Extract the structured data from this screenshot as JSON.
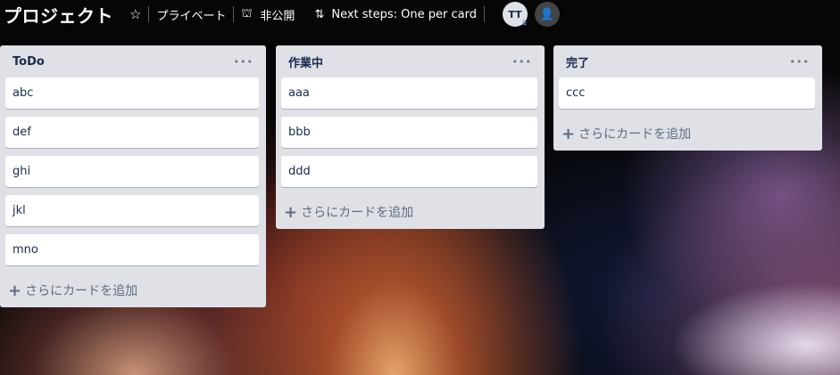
{
  "header": {
    "board_title": "プロジェクト",
    "star_icon": "☆",
    "visibility_private": "プライベート",
    "lock_icon": "⛫",
    "visibility_team": "非公開",
    "sort_icon": "⇅",
    "powerup": "Next steps: One per card",
    "avatar_initials": "TT",
    "avatar_badge": "⩯",
    "invite_icon": "👤"
  },
  "lists": [
    {
      "title": "ToDo",
      "menu": "•••",
      "cards": [
        "abc",
        "def",
        "ghi",
        "jkl",
        "mno"
      ],
      "add_card": "さらにカードを追加"
    },
    {
      "title": "作業中",
      "menu": "•••",
      "cards": [
        "aaa",
        "bbb",
        "ddd"
      ],
      "add_card": "さらにカードを追加"
    },
    {
      "title": "完了",
      "menu": "•••",
      "cards": [
        "ccc"
      ],
      "add_card": "さらにカードを追加"
    }
  ],
  "add_icon": "+"
}
